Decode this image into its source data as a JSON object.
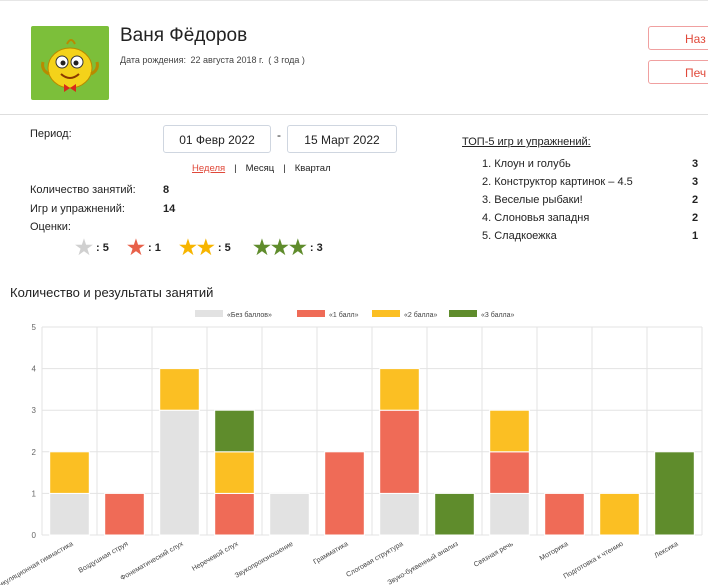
{
  "profile": {
    "name": "Ваня Фёдоров",
    "dob_label": "Дата рождения:",
    "dob_value": "22 августа 2018 г.",
    "age": "( 3 года )"
  },
  "buttons": {
    "top": "Наз",
    "print": "Печ"
  },
  "period": {
    "label": "Период:",
    "from": "01 Февр 2022",
    "to": "15 Март 2022",
    "sep": "-"
  },
  "range_tabs": [
    "Неделя",
    "Месяц",
    "Квартал"
  ],
  "range_tab_separator": "|",
  "stats": {
    "sessions_label": "Количество занятий:",
    "sessions_value": "8",
    "games_label": "Игр и упражнений:",
    "games_value": "14",
    "ratings_label": "Оценки:"
  },
  "ratings": [
    {
      "stars": 1,
      "color": "#d0d0d0",
      "count": ": 5"
    },
    {
      "stars": 1,
      "color": "#e8614a",
      "count": ": 1"
    },
    {
      "stars": 2,
      "color": "#f7b500",
      "count": ": 5"
    },
    {
      "stars": 3,
      "color": "#5f8c2c",
      "count": ": 3"
    }
  ],
  "top5": {
    "title": "ТОП-5 игр и упражнений:",
    "items": [
      {
        "label": "1. Клоун и голубь",
        "count": "3"
      },
      {
        "label": "2. Конструктор картинок – 4.5",
        "count": "3"
      },
      {
        "label": "3. Веселые рыбаки!",
        "count": "2"
      },
      {
        "label": "4. Слоновья западня",
        "count": "2"
      },
      {
        "label": "5. Сладкоежка",
        "count": "1"
      }
    ]
  },
  "section_title": "Количество и результаты занятий",
  "colors": {
    "accent": "#e0493a",
    "avatar_bg": "#7cbf3a"
  },
  "chart_data": {
    "type": "bar",
    "stacked": true,
    "categories": [
      "Артикуляционная гимнастика",
      "Воздушная струя",
      "Фонематический слух",
      "Неречевой слух",
      "Звукопроизношение",
      "Грамматика",
      "Слоговая структура",
      "Звуко-буквенный анализ",
      "Связная речь",
      "Моторика",
      "Подготовка к чтению",
      "Лексика"
    ],
    "series": [
      {
        "name": "«Без баллов»",
        "color": "#e2e2e2",
        "values": [
          1,
          0,
          3,
          0,
          1,
          0,
          1,
          0,
          1,
          0,
          0,
          0
        ]
      },
      {
        "name": "«1 балл»",
        "color": "#ef6b57",
        "values": [
          0,
          1,
          0,
          1,
          0,
          2,
          2,
          0,
          1,
          1,
          0,
          0
        ]
      },
      {
        "name": "«2 балла»",
        "color": "#fbbf23",
        "values": [
          1,
          0,
          1,
          1,
          0,
          0,
          1,
          0,
          1,
          0,
          1,
          0
        ]
      },
      {
        "name": "«3 балла»",
        "color": "#5f8c2c",
        "values": [
          0,
          0,
          0,
          1,
          0,
          0,
          0,
          1,
          0,
          0,
          0,
          2
        ]
      }
    ],
    "ylim": [
      0,
      5
    ],
    "yticks": [
      "0",
      "1",
      "2",
      "3",
      "4",
      "5"
    ],
    "grid": true,
    "legend": "top-center"
  }
}
